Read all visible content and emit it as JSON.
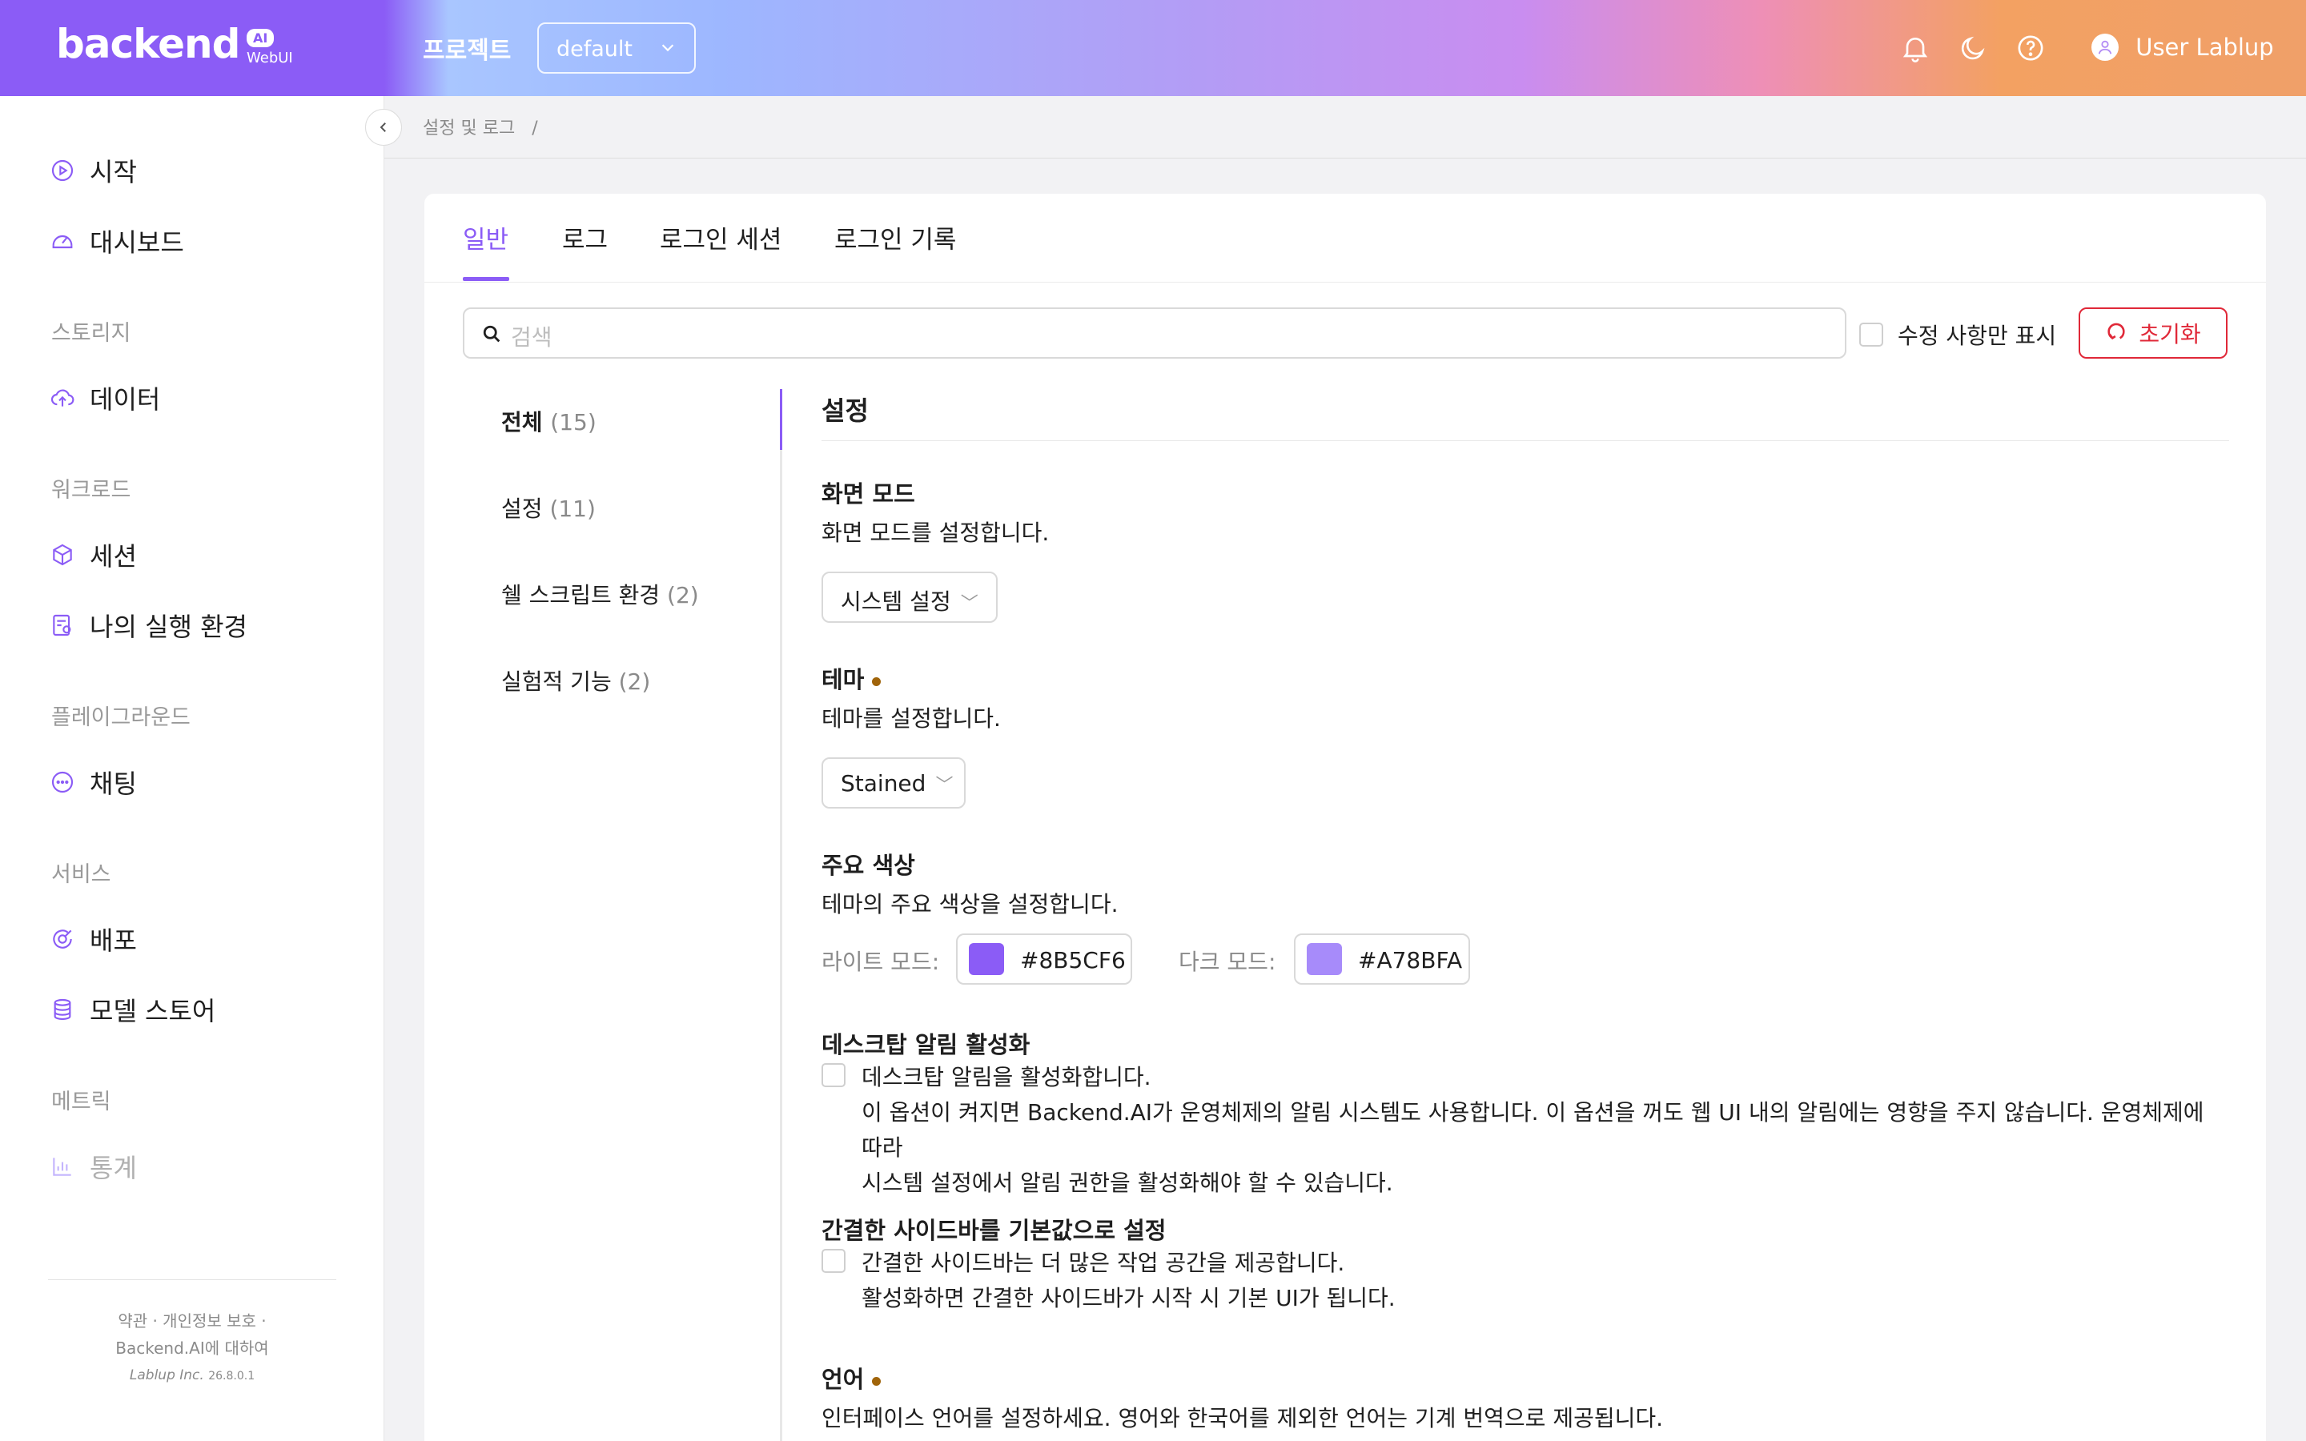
{
  "header": {
    "brand": "backend",
    "brand_badge": "AI",
    "brand_sub": "WebUI",
    "project_label": "프로젝트",
    "project_value": "default",
    "user_name": "User Lablup"
  },
  "sidebar": {
    "items": [
      {
        "label": "시작",
        "icon": "play-circle-icon"
      },
      {
        "label": "대시보드",
        "icon": "dashboard-icon"
      },
      {
        "label": "데이터",
        "icon": "cloud-upload-icon"
      },
      {
        "label": "세션",
        "icon": "cube-icon"
      },
      {
        "label": "나의 실행 환경",
        "icon": "environment-icon"
      },
      {
        "label": "채팅",
        "icon": "chat-icon"
      },
      {
        "label": "배포",
        "icon": "deploy-icon"
      },
      {
        "label": "모델 스토어",
        "icon": "database-icon"
      },
      {
        "label": "통계",
        "icon": "bar-chart-icon"
      }
    ],
    "groups": [
      "스토리지",
      "워크로드",
      "플레이그라운드",
      "서비스",
      "메트릭"
    ],
    "footer": {
      "links": "약관 · 개인정보 보호 ·",
      "about": "Backend.AI에 대하여",
      "company": "Lablup Inc.",
      "version": "26.8.0.1"
    }
  },
  "breadcrumb": {
    "items": "설정 및 로그",
    "separator": "/"
  },
  "tabs": [
    "일반",
    "로그",
    "로그인 세션",
    "로그인 기록"
  ],
  "search": {
    "placeholder": "검색"
  },
  "modified_only_label": "수정 사항만 표시",
  "reset_label": "초기화",
  "categories": [
    {
      "label": "전체",
      "count": "(15)"
    },
    {
      "label": "설정",
      "count": "(11)"
    },
    {
      "label": "쉘 스크립트 환경",
      "count": "(2)"
    },
    {
      "label": "실험적 기능",
      "count": "(2)"
    }
  ],
  "settings": {
    "section_title": "설정",
    "display_mode": {
      "title": "화면 모드",
      "desc": "화면 모드를 설정합니다.",
      "value": "시스템 설정"
    },
    "theme": {
      "title": "테마",
      "desc": "테마를 설정합니다.",
      "value": "Stained"
    },
    "primary_color": {
      "title": "주요 색상",
      "desc": "테마의 주요 색상을 설정합니다.",
      "light_label": "라이트 모드:",
      "light_value": "#8B5CF6",
      "dark_label": "다크 모드:",
      "dark_value": "#A78BFA"
    },
    "desktop_notification": {
      "title": "데스크탑 알림 활성화",
      "line1": "데스크탑 알림을 활성화합니다.",
      "line2": "이 옵션이 켜지면 Backend.AI가 운영체제의 알림 시스템도 사용합니다. 이 옵션을 꺼도 웹 UI 내의 알림에는 영향을 주지 않습니다. 운영체제에 따라",
      "line3": "시스템 설정에서 알림 권한을 활성화해야 할 수 있습니다."
    },
    "compact_sidebar": {
      "title": "간결한 사이드바를 기본값으로 설정",
      "line1": "간결한 사이드바는 더 많은 작업 공간을 제공합니다.",
      "line2": "활성화하면 간결한 사이드바가 시작 시 기본 UI가 됩니다."
    },
    "language": {
      "title": "언어",
      "desc": "인터페이스 언어를 설정하세요. 영어와 한국어를 제외한 언어는 기계 번역으로 제공됩니다."
    }
  },
  "colors": {
    "accent": "#8B5CF6",
    "danger": "#E02838",
    "modified_dot": "#A0640A"
  }
}
